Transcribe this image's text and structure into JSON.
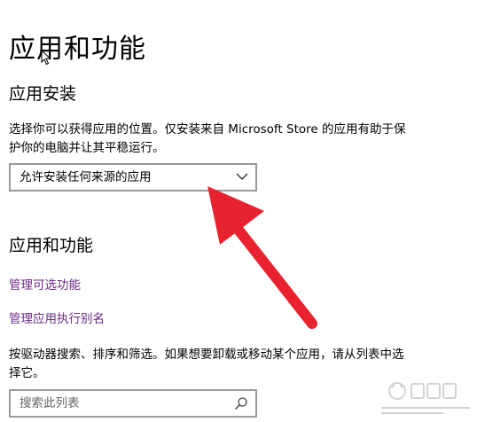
{
  "page": {
    "title": "应用和功能"
  },
  "install_section": {
    "heading": "应用安装",
    "description": "选择你可以获得应用的位置。仅安装来自 Microsoft Store 的应用有助于保护你的电脑并让其平稳运行。",
    "dropdown": {
      "selected": "允许安装任何来源的应用",
      "icon": "chevron-down-icon"
    }
  },
  "apps_section": {
    "heading": "应用和功能",
    "links": {
      "optional_features": "管理可选功能",
      "app_aliases": "管理应用执行别名"
    },
    "description": "按驱动器搜索、排序和筛选。如果想要卸载或移动某个应用，请从列表中选择它。",
    "search": {
      "placeholder": "搜索此列表",
      "icon": "search-icon"
    }
  },
  "colors": {
    "link": "#6b2a87",
    "annotation_arrow": "#e8232f",
    "border": "#999999"
  }
}
